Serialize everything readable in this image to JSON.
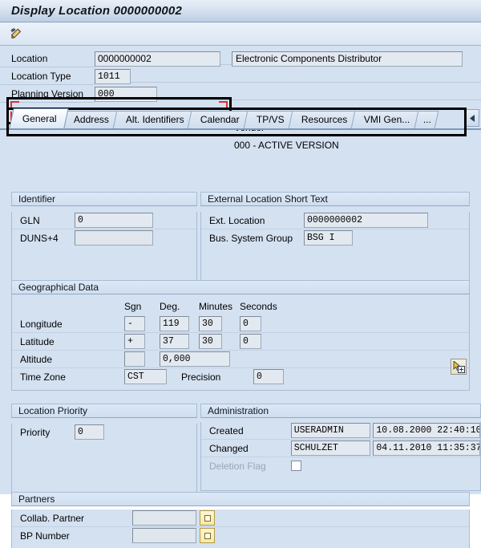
{
  "window": {
    "title": "Display Location 0000000002"
  },
  "toolbar": {
    "buttons": [
      {
        "name": "edit-pencil-icon",
        "label": ""
      }
    ]
  },
  "header": {
    "rows": [
      {
        "label": "Location",
        "value": "0000000002",
        "side": "Electronic Components Distributor",
        "side_boxed": true
      },
      {
        "label": "Location Type",
        "value": "1011",
        "side": "Vendor",
        "side_boxed": false
      },
      {
        "label": "Planning Version",
        "value": "000",
        "side": "000 - ACTIVE VERSION",
        "side_boxed": false
      }
    ]
  },
  "tabs": {
    "items": [
      {
        "label": "General",
        "active": true
      },
      {
        "label": "Address",
        "active": false
      },
      {
        "label": "Alt. Identifiers",
        "active": false
      },
      {
        "label": "Calendar",
        "active": false
      },
      {
        "label": "TP/VS",
        "active": false
      },
      {
        "label": "Resources",
        "active": false
      },
      {
        "label": "VMI Gen...",
        "active": false
      },
      {
        "label": "...",
        "active": false
      }
    ],
    "scroll_left_label": "◄"
  },
  "identifier": {
    "title": "Identifier",
    "fields": [
      {
        "label": "GLN",
        "value": "0"
      },
      {
        "label": "DUNS+4",
        "value": ""
      }
    ]
  },
  "external_location": {
    "title": "External Location Short Text",
    "fields": [
      {
        "label": "Ext. Location",
        "value": "0000000002"
      },
      {
        "label": "Bus. System Group",
        "value": "BSG I"
      }
    ]
  },
  "geographical": {
    "title": "Geographical Data",
    "columns": [
      "Sgn",
      "Deg.",
      "Minutes",
      "Seconds"
    ],
    "rows": [
      {
        "label": "Longitude",
        "sgn": "-",
        "deg": "119",
        "minutes": "30",
        "seconds": "0"
      },
      {
        "label": "Latitude",
        "sgn": "+",
        "deg": "37",
        "minutes": "30",
        "seconds": "0"
      }
    ],
    "altitude": {
      "label": "Altitude",
      "sgn": "",
      "value": "0,000"
    },
    "timezone": {
      "label": "Time Zone",
      "value": "CST"
    },
    "precision": {
      "label": "Precision",
      "value": "0"
    },
    "map_button_name": "map-select-icon"
  },
  "location_priority": {
    "title": "Location Priority",
    "fields": [
      {
        "label": "Priority",
        "value": "0"
      }
    ]
  },
  "administration": {
    "title": "Administration",
    "rows": [
      {
        "label": "Created",
        "user": "USERADMIN",
        "timestamp": "10.08.2000 22:40:10"
      },
      {
        "label": "Changed",
        "user": "SCHULZET",
        "timestamp": "04.11.2010 11:35:37"
      }
    ],
    "deletion_flag": {
      "label": "Deletion Flag",
      "checked": false
    }
  },
  "partners": {
    "title": "Partners",
    "fields": [
      {
        "label": "Collab. Partner",
        "value": ""
      },
      {
        "label": "BP Number",
        "value": ""
      }
    ]
  },
  "colors": {
    "page_background": "#d4e1f1",
    "title_accent": "#bccee4",
    "highlight_border": "#000000",
    "highlight_corner": "#e03030",
    "f4_button": "#f6e9a8"
  }
}
